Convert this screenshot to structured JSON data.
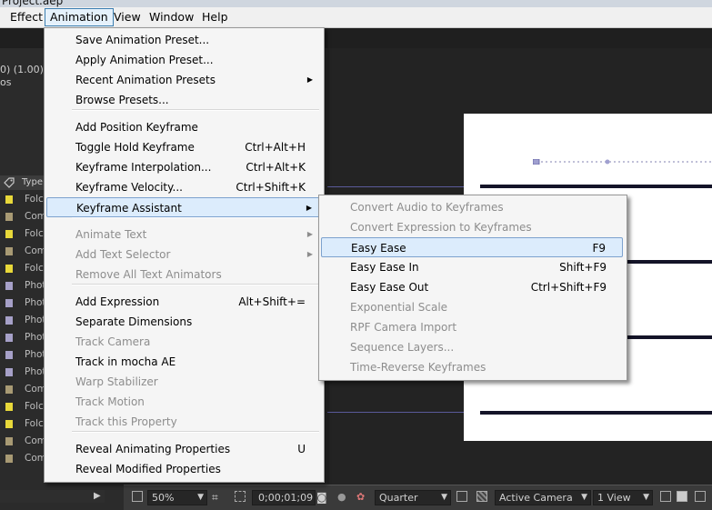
{
  "window": {
    "title": "Project.aep"
  },
  "menubar": {
    "items": [
      "Effect",
      "Animation",
      "View",
      "Window",
      "Help"
    ]
  },
  "info_panel": {
    "line1": "0) (1.00)",
    "line2": "os"
  },
  "project_panel": {
    "type_header": "Type",
    "rows": [
      {
        "type": "Folc",
        "color": "#e8d83a"
      },
      {
        "type": "Com",
        "color": "#a89a74"
      },
      {
        "type": "Folc",
        "color": "#e8d83a"
      },
      {
        "type": "Com",
        "color": "#a89a74"
      },
      {
        "type": "Folc",
        "color": "#e8d83a"
      },
      {
        "type": "Phot",
        "color": "#a6a0c8"
      },
      {
        "type": "Phot",
        "color": "#a6a0c8"
      },
      {
        "type": "Phot",
        "color": "#a6a0c8"
      },
      {
        "type": "Phot",
        "color": "#a6a0c8"
      },
      {
        "type": "Phot",
        "color": "#a6a0c8"
      },
      {
        "type": "Phot",
        "color": "#a6a0c8"
      },
      {
        "type": "Com",
        "color": "#a89a74"
      },
      {
        "type": "Folc",
        "color": "#e8d83a"
      },
      {
        "type": "Folc",
        "color": "#e8d83a"
      },
      {
        "type": "Com",
        "color": "#a89a74"
      },
      {
        "type": "Com",
        "color": "#a89a74"
      }
    ]
  },
  "animation_menu": {
    "items": [
      {
        "label": "Save Animation Preset...",
        "shortcut": "",
        "submenu": false,
        "disabled": false
      },
      {
        "label": "Apply Animation Preset...",
        "shortcut": "",
        "submenu": false,
        "disabled": false
      },
      {
        "label": "Recent Animation Presets",
        "shortcut": "",
        "submenu": true,
        "disabled": false
      },
      {
        "label": "Browse Presets...",
        "shortcut": "",
        "submenu": false,
        "disabled": false
      },
      {
        "label": "Add Position Keyframe",
        "shortcut": "",
        "submenu": false,
        "disabled": false
      },
      {
        "label": "Toggle Hold Keyframe",
        "shortcut": "Ctrl+Alt+H",
        "submenu": false,
        "disabled": false
      },
      {
        "label": "Keyframe Interpolation...",
        "shortcut": "Ctrl+Alt+K",
        "submenu": false,
        "disabled": false
      },
      {
        "label": "Keyframe Velocity...",
        "shortcut": "Ctrl+Shift+K",
        "submenu": false,
        "disabled": false
      },
      {
        "label": "Keyframe Assistant",
        "shortcut": "",
        "submenu": true,
        "disabled": false,
        "highlighted": true
      },
      {
        "label": "Animate Text",
        "shortcut": "",
        "submenu": true,
        "disabled": true
      },
      {
        "label": "Add Text Selector",
        "shortcut": "",
        "submenu": true,
        "disabled": true
      },
      {
        "label": "Remove All Text Animators",
        "shortcut": "",
        "submenu": false,
        "disabled": true
      },
      {
        "label": "Add Expression",
        "shortcut": "Alt+Shift+=",
        "submenu": false,
        "disabled": false
      },
      {
        "label": "Separate Dimensions",
        "shortcut": "",
        "submenu": false,
        "disabled": false
      },
      {
        "label": "Track Camera",
        "shortcut": "",
        "submenu": false,
        "disabled": true
      },
      {
        "label": "Track in mocha AE",
        "shortcut": "",
        "submenu": false,
        "disabled": false
      },
      {
        "label": "Warp Stabilizer",
        "shortcut": "",
        "submenu": false,
        "disabled": true
      },
      {
        "label": "Track Motion",
        "shortcut": "",
        "submenu": false,
        "disabled": true
      },
      {
        "label": "Track this Property",
        "shortcut": "",
        "submenu": false,
        "disabled": true
      },
      {
        "label": "Reveal Animating Properties",
        "shortcut": "U",
        "submenu": false,
        "disabled": false
      },
      {
        "label": "Reveal Modified Properties",
        "shortcut": "",
        "submenu": false,
        "disabled": false
      }
    ]
  },
  "keyframe_assistant_menu": {
    "items": [
      {
        "label": "Convert Audio to Keyframes",
        "shortcut": "",
        "disabled": true
      },
      {
        "label": "Convert Expression to Keyframes",
        "shortcut": "",
        "disabled": true
      },
      {
        "label": "Easy Ease",
        "shortcut": "F9",
        "disabled": false,
        "highlighted": true
      },
      {
        "label": "Easy Ease In",
        "shortcut": "Shift+F9",
        "disabled": false
      },
      {
        "label": "Easy Ease Out",
        "shortcut": "Ctrl+Shift+F9",
        "disabled": false
      },
      {
        "label": "Exponential Scale",
        "shortcut": "",
        "disabled": true
      },
      {
        "label": "RPF Camera Import",
        "shortcut": "",
        "disabled": true
      },
      {
        "label": "Sequence Layers...",
        "shortcut": "",
        "disabled": true
      },
      {
        "label": "Time-Reverse Keyframes",
        "shortcut": "",
        "disabled": true
      }
    ]
  },
  "status_bar": {
    "zoom": "50%",
    "timecode": "0;00;01;09",
    "resolution": "Quarter",
    "camera": "Active Camera",
    "view": "1 View"
  },
  "colors": {
    "highlight": "#dcecfc",
    "menu_bg": "#f5f5f5",
    "disabled_text": "#8d8d8d"
  }
}
